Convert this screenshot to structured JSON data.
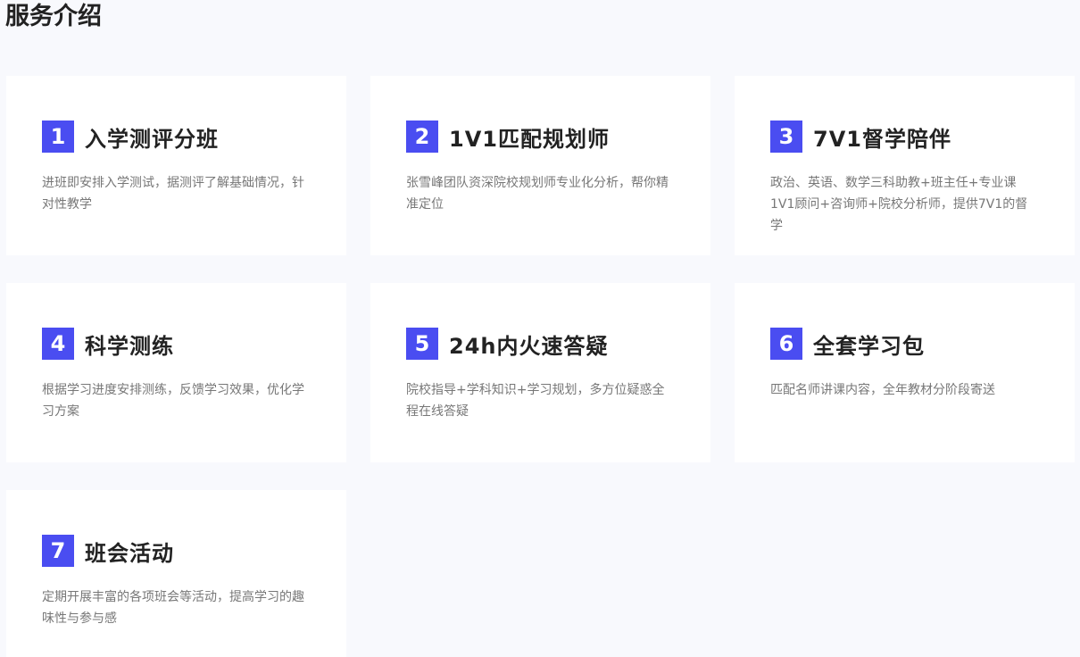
{
  "page": {
    "title": "服务介绍"
  },
  "cards": [
    {
      "number": "1",
      "title": "入学测评分班",
      "description": "进班即安排入学测试，据测评了解基础情况，针对性教学"
    },
    {
      "number": "2",
      "title": "1V1匹配规划师",
      "description": "张雪峰团队资深院校规划师专业化分析，帮你精准定位"
    },
    {
      "number": "3",
      "title": "7V1督学陪伴",
      "description": "政治、英语、数学三科助教+班主任+专业课1V1顾问+咨询师+院校分析师，提供7V1的督学"
    },
    {
      "number": "4",
      "title": "科学测练",
      "description": "根据学习进度安排测练，反馈学习效果，优化学习方案"
    },
    {
      "number": "5",
      "title": "24h内火速答疑",
      "description": "院校指导+学科知识+学习规划，多方位疑惑全程在线答疑"
    },
    {
      "number": "6",
      "title": "全套学习包",
      "description": "匹配名师讲课内容，全年教材分阶段寄送"
    },
    {
      "number": "7",
      "title": "班会活动",
      "description": "定期开展丰富的各项班会等活动，提高学习的趣味性与参与感"
    }
  ],
  "colors": {
    "accent": "#4a4df1",
    "background": "#f8f9fd",
    "card": "#ffffff",
    "title_text": "#222222",
    "desc_text": "#777777"
  }
}
